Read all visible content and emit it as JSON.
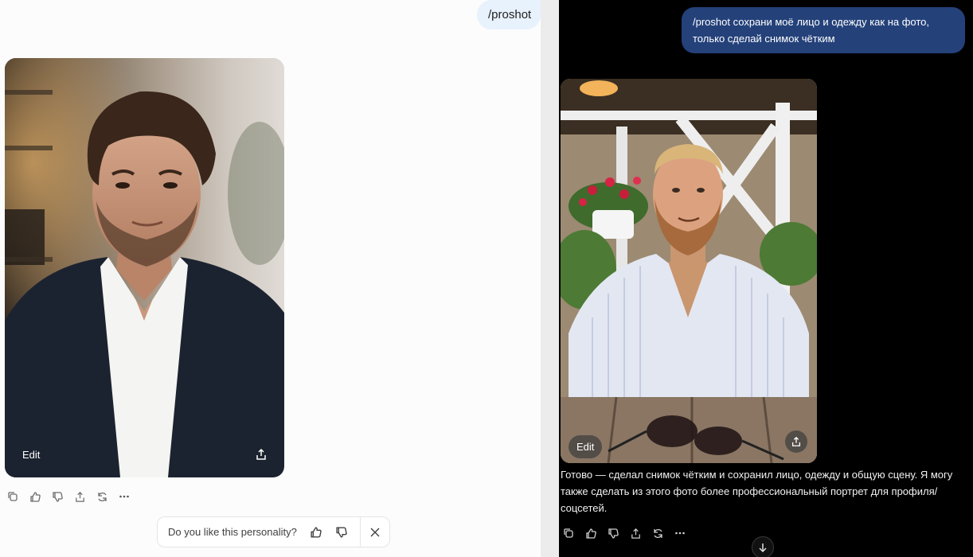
{
  "left_chat": {
    "user_message": "/proshot",
    "image": {
      "edit_label": "Edit",
      "share": "share-icon",
      "subject": "portrait-man-dark-blazer-white-shirt"
    },
    "message_actions": [
      "copy-icon",
      "thumbs-up-icon",
      "thumbs-down-icon",
      "share-icon",
      "regenerate-icon",
      "more-icon"
    ],
    "feedback": {
      "question": "Do you like this personality?",
      "like": "thumbs-up-icon",
      "dislike": "thumbs-down-icon",
      "close": "close-icon"
    }
  },
  "right_chat": {
    "user_message": "/proshot сохрани моё лицо и одежду как на фото, только сделай снимок чётким",
    "image": {
      "edit_label": "Edit",
      "share": "share-icon",
      "subject": "photo-man-striped-shirt-cafe"
    },
    "assistant_reply": "Готово — сделал снимок чётким и сохранил лицо, одежду и общую сцену. Я могу также сделать из этого фото более профессиональный портрет для профиля/соцсетей.",
    "message_actions": [
      "copy-icon",
      "thumbs-up-icon",
      "thumbs-down-icon",
      "share-icon",
      "regenerate-icon",
      "more-icon"
    ],
    "scroll_down": "arrow-down-icon"
  },
  "colors": {
    "left_bg": "#fcfcfc",
    "left_bubble": "#e8f2fd",
    "right_bg": "#000000",
    "right_bubble": "#24417a",
    "divider": "#ececec"
  }
}
